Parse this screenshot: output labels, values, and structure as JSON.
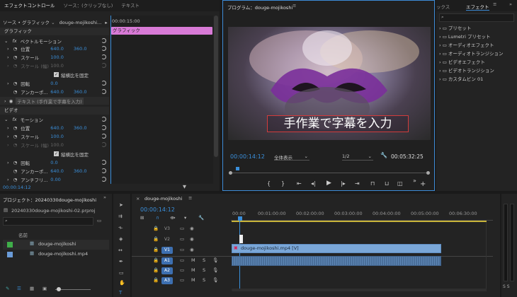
{
  "effect_controls": {
    "tabs": [
      "エフェクトコントロール",
      "ソース：(クリップなし)",
      "テキスト"
    ],
    "source_label": "ソース • グラフィック",
    "clip_label": "douge-mojikoshi...",
    "timecode_top": "00:00:15:00",
    "clip_bar_label": "グラフィック",
    "section_graphic": "グラフィック",
    "vector_motion": "ベクトルモーション",
    "position": "位置",
    "pos_x": "640.0",
    "pos_y": "360.0",
    "scale": "スケール",
    "scale_val": "100.0",
    "scale_width": "スケール (幅)",
    "scale_width_val": "100.0",
    "uniform": "縦横比を固定",
    "rotation": "回転",
    "rotation_val": "0.0",
    "anchor": "アンカーポ...",
    "anchor_x": "640.0",
    "anchor_y": "360.0",
    "text_layer": "テキスト (手作業で字幕を入力)",
    "section_video": "ビデオ",
    "motion": "モーション",
    "antiflicker": "アンチフリ...",
    "antiflicker_val": "0.00",
    "bottom_timecode": "00:00:14:12"
  },
  "program": {
    "title": "プログラム：douge-mojikoshi",
    "caption": "手作業で字幕を入力",
    "timecode": "00:00:14:12",
    "zoom": "全体表示",
    "resolution": "1/2",
    "duration": "00:05:32:25"
  },
  "effects": {
    "tab_partial": "ックス",
    "tab": "エフェクト",
    "items": [
      "プリセット",
      "Lumetri プリセット",
      "オーディオエフェクト",
      "オーディオトランジション",
      "ビデオエフェクト",
      "ビデオトランジション",
      "カスタムビン 01"
    ]
  },
  "project": {
    "title": "プロジェクト：20240330douge-mojikoshi",
    "file": "20240330douge-mojikoshi-02.prproj",
    "col_name": "名前",
    "items": [
      "douge-mojikoshi",
      "douge-mojikoshi.mp4"
    ],
    "colors": [
      "#3fae49",
      "#6a9bd8"
    ]
  },
  "timeline": {
    "tab": "douge-mojikoshi",
    "timecode": "00:00:14:12",
    "ruler": [
      "00:00",
      "00:01:00:00",
      "00:02:00:00",
      "00:03:00:00",
      "00:04:00:00",
      "00:05:00:00",
      "00:06:30:00"
    ],
    "tracks_video": [
      "V3",
      "V2",
      "V1"
    ],
    "tracks_audio": [
      "A1",
      "A2",
      "A3"
    ],
    "clip_video": "douge-mojikoshi.mp4 [V]",
    "m": "M",
    "s": "S"
  },
  "meter": {
    "labels": "S S"
  }
}
